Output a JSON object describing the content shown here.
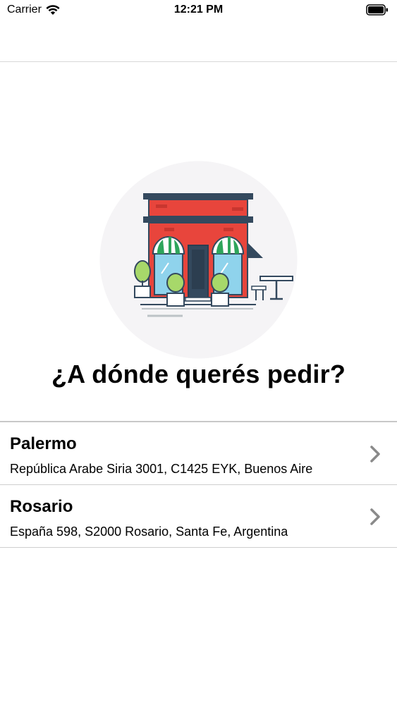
{
  "status_bar": {
    "carrier": "Carrier",
    "time": "12:21 PM"
  },
  "main": {
    "headline": "¿A dónde querés pedir?"
  },
  "locations": [
    {
      "name": "Palermo",
      "address": "República Arabe Siria 3001, C1425 EYK, Buenos Aire"
    },
    {
      "name": "Rosario",
      "address": "España 598, S2000 Rosario, Santa Fe, Argentina"
    }
  ],
  "icons": {
    "hero": "store-illustration",
    "row_accessory": "chevron-right-icon"
  },
  "colors": {
    "store_red": "#e8453c",
    "awning_green": "#2ea55b",
    "roof_navy": "#34495e",
    "chevron_gray": "#8a8a8a"
  }
}
